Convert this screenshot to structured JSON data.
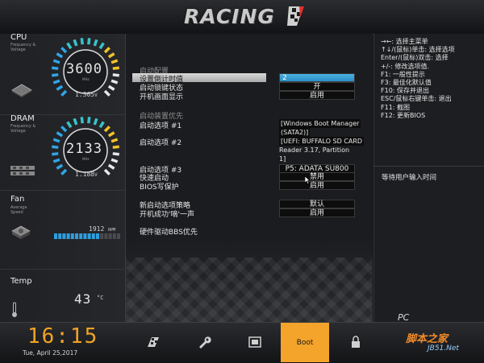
{
  "header": {
    "logo": "RACING"
  },
  "left": {
    "cpu": {
      "title": "CPU",
      "sub1": "Frequency &",
      "sub2": "Voltage",
      "value": "3600",
      "unit": "MHz",
      "voltage": "1.305",
      "voltage_unit": "V"
    },
    "dram": {
      "title": "DRAM",
      "sub1": "Frequency &",
      "sub2": "Voltage",
      "value": "2133",
      "unit": "MHz",
      "voltage": "1.188",
      "voltage_unit": "V"
    },
    "fan": {
      "title": "Fan",
      "sub1": "Average",
      "sub2": "Speed",
      "rpm": "1912",
      "unit": "RPM",
      "level": 0.65
    },
    "temp": {
      "title": "Temp",
      "value": "43",
      "unit": "°C"
    }
  },
  "center": {
    "group1": "启动配置",
    "rows": [
      {
        "label": "设置倒计时值",
        "value": "2"
      },
      {
        "label": "启动锁键状态",
        "value": "开"
      },
      {
        "label": "开机画面显示",
        "value": "启用"
      }
    ],
    "group2": "启动装置优先",
    "boot1_label": "启动选项 #1",
    "boot1_line1": "[Windows Boot Manager",
    "boot1_line2": "(SATA2)]",
    "boot2_label": "启动选项 #2",
    "boot2_line1": "[UEFI: BUFFALO SD CARD",
    "boot2_line2": "Reader 3.17, Partition",
    "boot2_line3": "1]",
    "boot3_label": "启动选项 #3",
    "boot3_value": "P5: ADATA SU800",
    "fastboot_label": "快速启动",
    "fastboot_value": "禁用",
    "bioswp_label": "BIOS写保护",
    "bioswp_value": "启用",
    "newboot_label": "新启动选项策略",
    "newboot_value": "默认",
    "beep_label": "开机成功'嘀'一声",
    "beep_value": "启用",
    "hdd_label": "硬件驱动BBS优先"
  },
  "right": {
    "help": [
      "→←: 选择主菜单",
      "↑↓/(鼠标)单击: 选择选项",
      "Enter/(鼠标)双击: 选择",
      "+/-: 修改选项值.",
      "F1: 一般性提示",
      "F3: 最佳化默认值",
      "F10: 保存并退出",
      "ESC/鼠标右键单击: 退出",
      "F11: 截图",
      "F12: 更新BIOS"
    ],
    "wait": "等待用户输入时间"
  },
  "footer": {
    "time": "16:15",
    "date": "Tue,  April  25,2017",
    "tabs": [
      "",
      "",
      "",
      "Boot",
      "",
      ""
    ],
    "active_tab": "Boot"
  },
  "watermark": {
    "line1": "PC",
    "line2": "脚本之家",
    "line3": "JB51.Net"
  }
}
